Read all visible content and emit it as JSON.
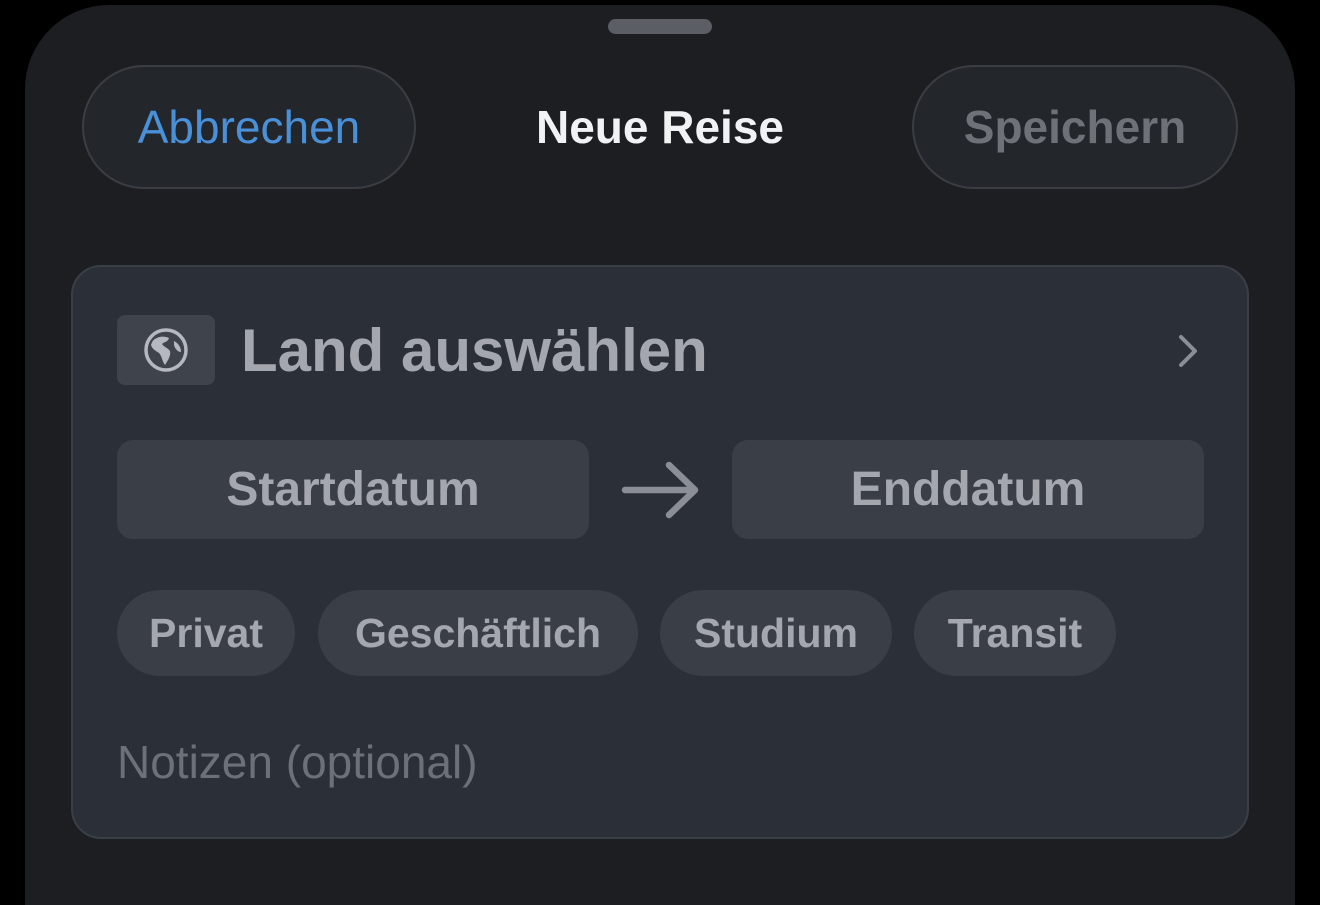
{
  "header": {
    "cancel_label": "Abbrechen",
    "title": "Neue Reise",
    "save_label": "Speichern"
  },
  "form": {
    "country_icon": "globe-icon",
    "country_placeholder": "Land auswählen",
    "start_date_label": "Startdatum",
    "end_date_label": "Enddatum",
    "trip_types": [
      "Privat",
      "Geschäftlich",
      "Studium",
      "Transit"
    ],
    "notes_placeholder": "Notizen (optional)",
    "notes_value": ""
  },
  "colors": {
    "accent": "#4a90d9",
    "background": "#1c1e22",
    "card": "#2b3038",
    "control": "#3a3e46"
  }
}
